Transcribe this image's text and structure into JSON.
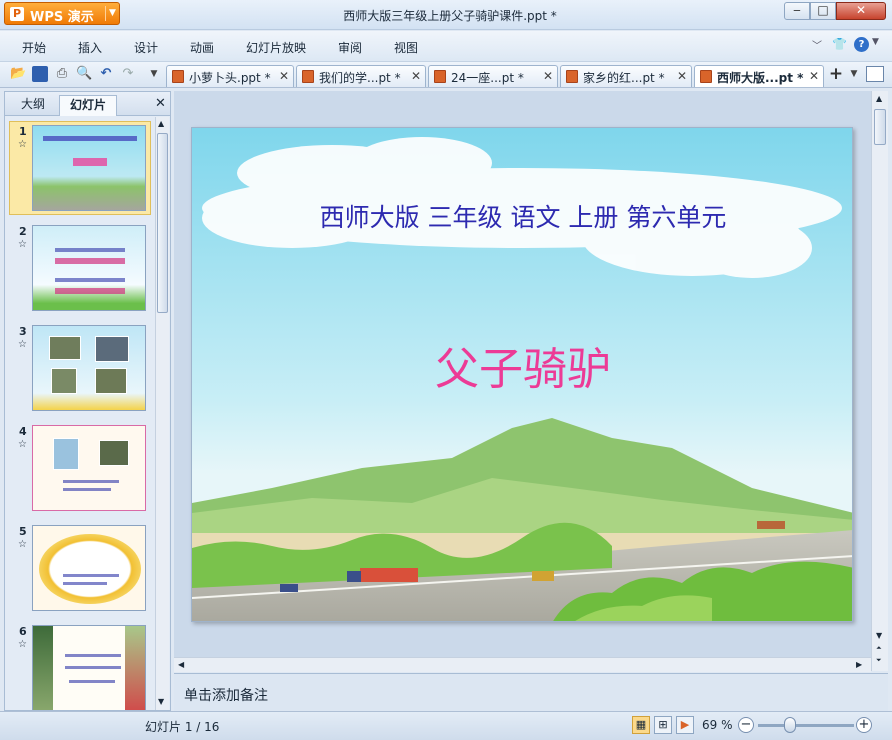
{
  "app": {
    "button_label": "WPS 演示",
    "logo_glyph": "P"
  },
  "window": {
    "title": "西师大版三年级上册父子骑驴课件.ppt *",
    "minimize": "▭",
    "maximize": "□",
    "close": "✕"
  },
  "menu": {
    "items": [
      "开始",
      "插入",
      "设计",
      "动画",
      "幻灯片放映",
      "审阅",
      "视图"
    ]
  },
  "tabs": {
    "items": [
      {
        "label": "小萝卜头.ppt *"
      },
      {
        "label": "我们的学...pt *"
      },
      {
        "label": "24一座...pt *"
      },
      {
        "label": "家乡的红...pt *"
      },
      {
        "label": "西师大版...pt *",
        "active": true
      }
    ],
    "close_glyph": "✕",
    "new_tab_glyph": "+"
  },
  "left_pane": {
    "tab_outline": "大纲",
    "tab_slides": "幻灯片",
    "close_glyph": "✕",
    "thumbnails": [
      {
        "num": "1",
        "selected": true
      },
      {
        "num": "2"
      },
      {
        "num": "3"
      },
      {
        "num": "4"
      },
      {
        "num": "5"
      },
      {
        "num": "6"
      }
    ]
  },
  "slide": {
    "subtitle": "西师大版 三年级 语文 上册 第六单元",
    "title": "父子骑驴"
  },
  "notes": {
    "placeholder": "单击添加备注"
  },
  "status": {
    "slide_indicator": "幻灯片 1 / 16",
    "zoom": "69 %"
  },
  "colors": {
    "accent_orange": "#f07a05",
    "title_pink": "#ec3b96",
    "subtitle_blue": "#2d2ab0"
  }
}
